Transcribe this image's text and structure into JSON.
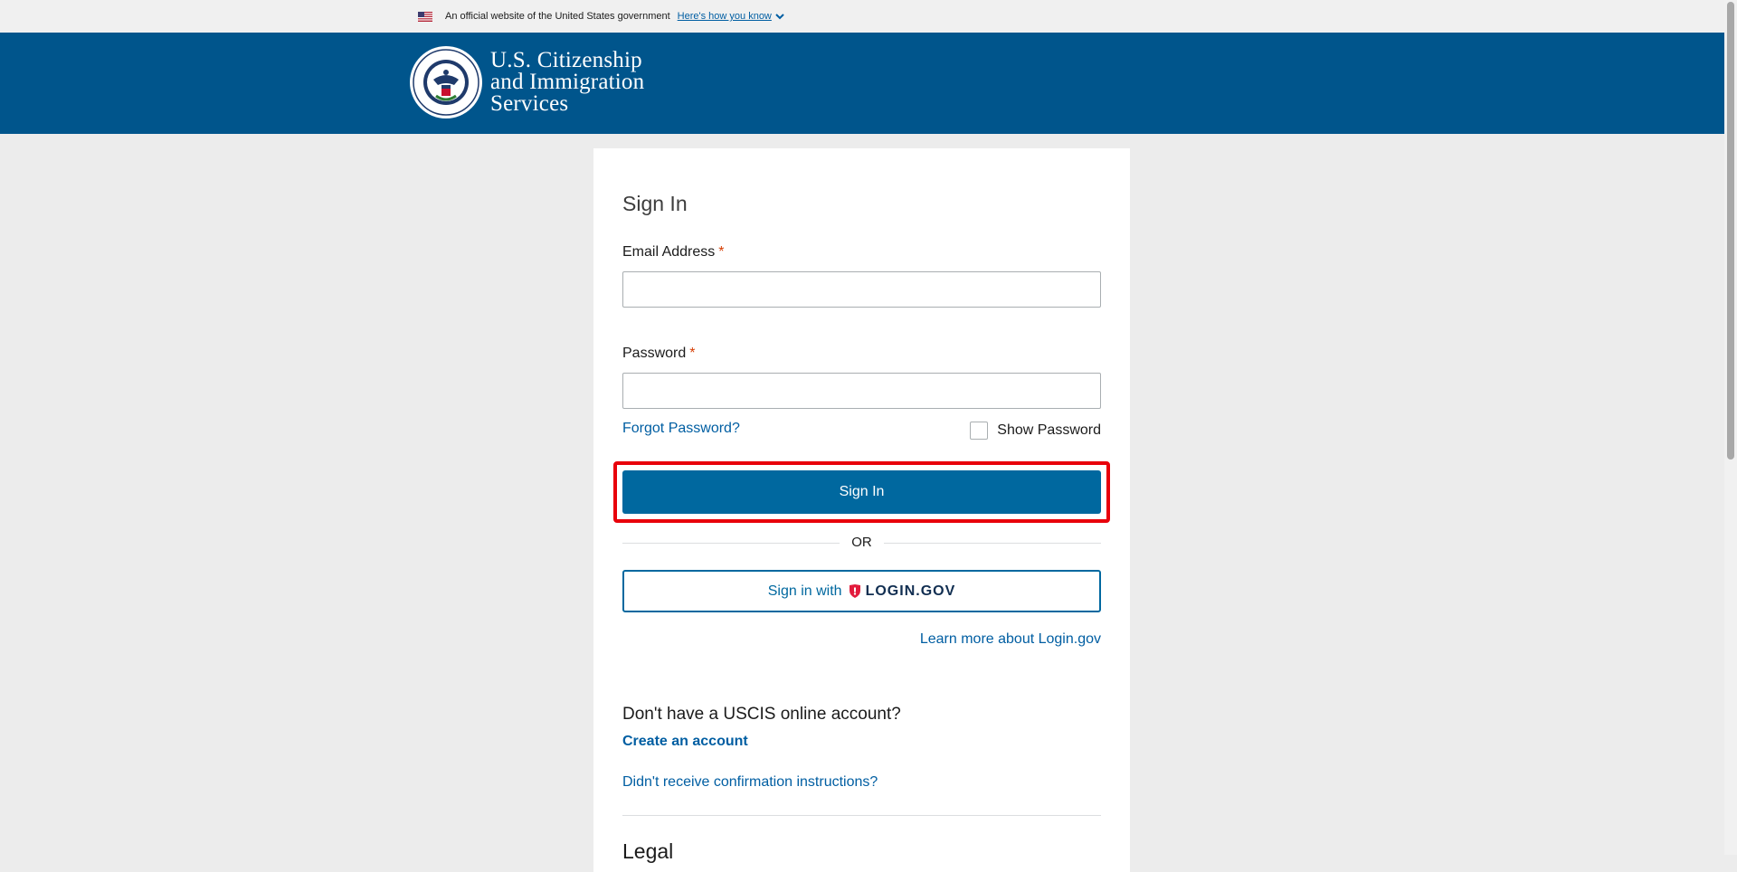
{
  "banner": {
    "text": "An official website of the United States government",
    "link": "Here's how you know"
  },
  "header": {
    "agency_line1": "U.S. Citizenship",
    "agency_line2": "and Immigration",
    "agency_line3": "Services"
  },
  "form": {
    "title": "Sign In",
    "email_label": "Email Address",
    "password_label": "Password",
    "required_mark": "*",
    "email_value": "",
    "password_value": "",
    "forgot": "Forgot Password?",
    "show_password": "Show Password",
    "sign_in": "Sign In",
    "or": "OR",
    "sign_in_with": "Sign in with",
    "login_gov": "LOGIN.GOV",
    "learn_more": "Learn more about Login.gov"
  },
  "account": {
    "heading": "Don't have a USCIS online account?",
    "create": "Create an account",
    "didnt_receive": "Didn't receive confirmation instructions?",
    "legal": "Legal"
  },
  "colors": {
    "header_bg": "#00558c",
    "primary": "#00689f",
    "highlight": "#e8000b",
    "required": "#d63e04"
  }
}
